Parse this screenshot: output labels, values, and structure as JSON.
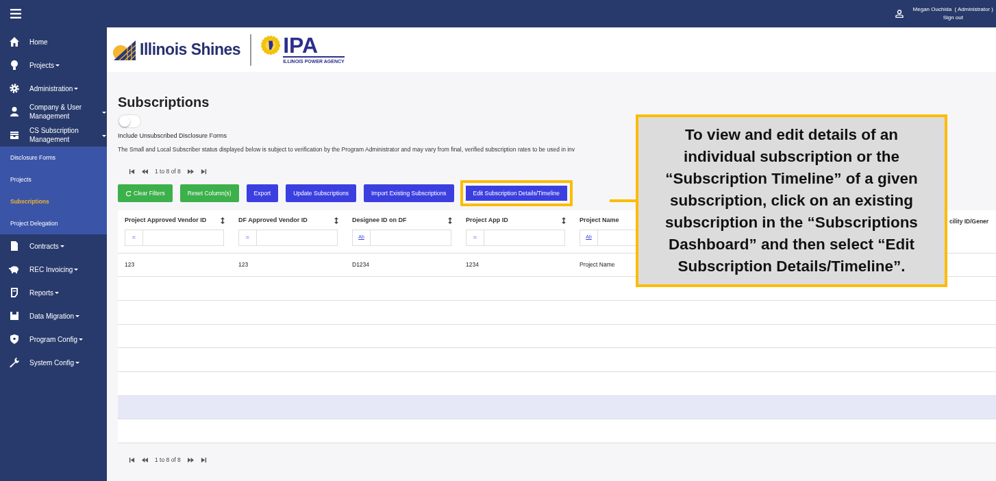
{
  "top_bar": {
    "user": "Megan Ouchida  ( Administrator )",
    "sign_out": "Sign out"
  },
  "sidebar": {
    "items": [
      {
        "label": "Home",
        "has_dropdown": false,
        "expanded": false
      },
      {
        "label": "Projects",
        "has_dropdown": true,
        "expanded": false
      },
      {
        "label": "Administration",
        "has_dropdown": true,
        "expanded": false
      },
      {
        "label": "Company & User Management",
        "has_dropdown": true,
        "expanded": false
      },
      {
        "label": "CS Subscription Management",
        "has_dropdown": true,
        "expanded": true,
        "children": [
          {
            "label": "Disclosure Forms",
            "selected": false
          },
          {
            "label": "Projects",
            "selected": false
          },
          {
            "label": "Subscriptions",
            "selected": true
          },
          {
            "label": "Project Delegation",
            "selected": false
          }
        ]
      },
      {
        "label": "Contracts",
        "has_dropdown": true,
        "expanded": false
      },
      {
        "label": "REC Invoicing",
        "has_dropdown": true,
        "expanded": false
      },
      {
        "label": "Reports",
        "has_dropdown": true,
        "expanded": false
      },
      {
        "label": "Data Migration",
        "has_dropdown": true,
        "expanded": false
      },
      {
        "label": "Program Config",
        "has_dropdown": true,
        "expanded": false
      },
      {
        "label": "System Config",
        "has_dropdown": true,
        "expanded": false
      }
    ]
  },
  "header": {
    "logo": "Illinois Shines",
    "agency_abbr": "IPA",
    "agency_name": "ILLINOIS POWER AGENCY"
  },
  "page": {
    "title": "Subscriptions",
    "toggle": {
      "label": "Include Unsubscribed Disclosure Forms",
      "on": false
    },
    "disclaimer": "The Small and Local Subscriber status displayed below is subject to verification by the Program Administrator and may vary from final, verified subscription rates to be used in inv",
    "pager_top": {
      "text": "1 to 8 of 8"
    },
    "buttons": [
      {
        "label": "Clear Filters",
        "kind": "success",
        "has_icon": true,
        "highlighted": false
      },
      {
        "label": "Reset Column(s)",
        "kind": "success",
        "has_icon": false,
        "highlighted": false
      },
      {
        "label": "Export",
        "kind": "primary",
        "has_icon": false,
        "highlighted": false
      },
      {
        "label": "Update Subscriptions",
        "kind": "primary",
        "has_icon": false,
        "highlighted": false
      },
      {
        "label": "Import Existing Subscriptions",
        "kind": "primary",
        "has_icon": false,
        "highlighted": false
      },
      {
        "label": "Edit Subscription Details/Timeline",
        "kind": "primary",
        "has_icon": false,
        "highlighted": true
      }
    ],
    "table": {
      "columns": [
        {
          "label": "Project Approved Vendor ID",
          "filter_op": "=",
          "sortable": true
        },
        {
          "label": "DF Approved Vendor ID",
          "filter_op": "=",
          "sortable": true
        },
        {
          "label": "Designee ID on DF",
          "filter_op": "Ab",
          "sortable": true
        },
        {
          "label": "Project App ID",
          "filter_op": "=",
          "sortable": true
        },
        {
          "label": "Project Name",
          "filter_op": "Ab"
        },
        {
          "label": "cility ID/Gener"
        }
      ],
      "rows": [
        {
          "cells": [
            "123",
            "123",
            "D1234",
            "1234",
            "Project Name"
          ],
          "selected": false
        },
        {
          "selected": false
        },
        {
          "selected": false
        },
        {
          "selected": false
        },
        {
          "selected": false
        },
        {
          "selected": false
        },
        {
          "selected": true
        },
        {
          "selected": false
        }
      ]
    },
    "pager_bottom": {
      "text": "1 to 8 of 8"
    }
  },
  "callout": {
    "text": "To view and edit details of an individual subscription or the “Subscription Timeline” of a given subscription, click on an existing subscription in the “Subscriptions Dashboard” and then select “Edit Subscription Details/Timeline”."
  }
}
